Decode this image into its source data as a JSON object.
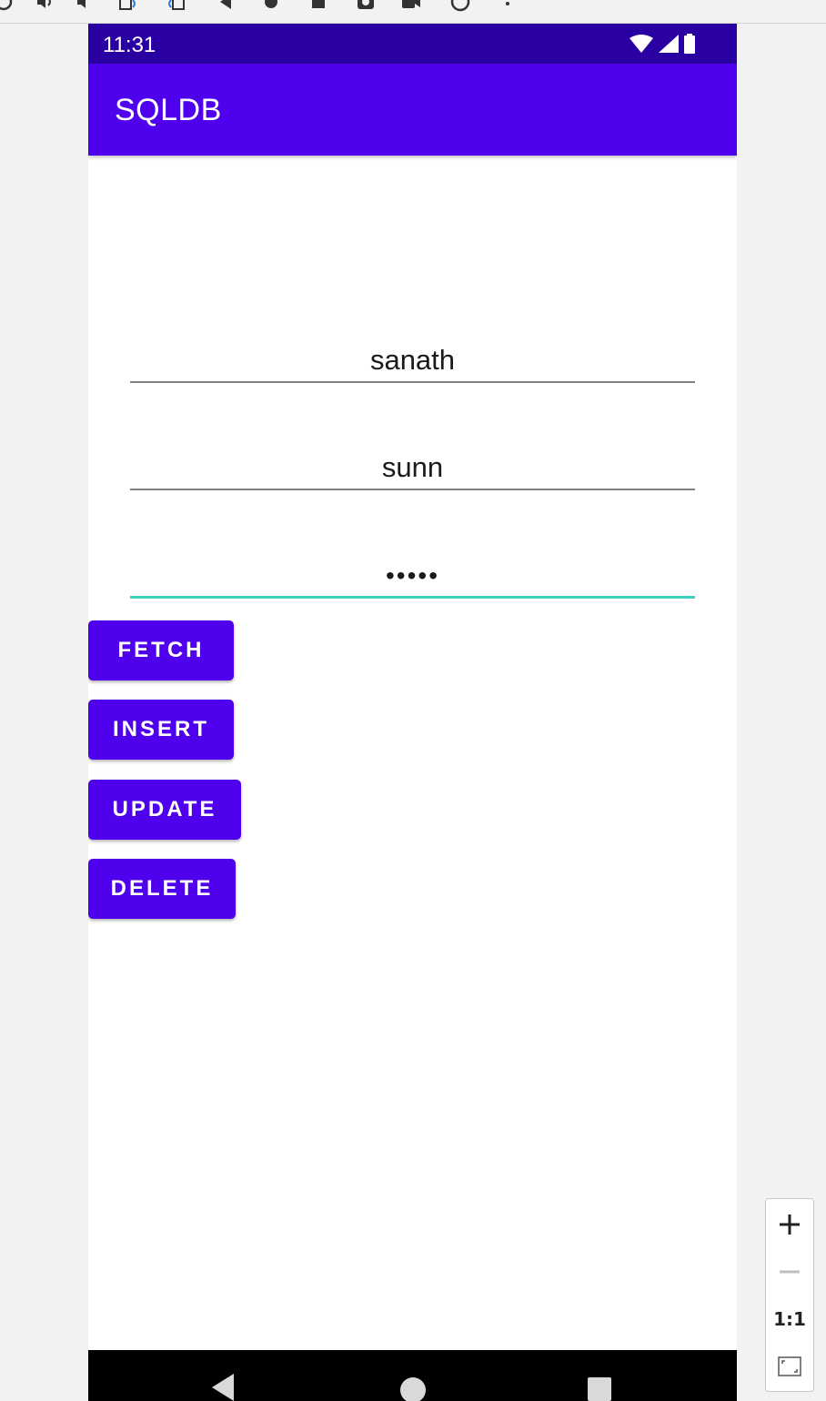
{
  "status_bar": {
    "time": "11:31"
  },
  "app_bar": {
    "title": "SQLDB"
  },
  "form": {
    "name_value": "sanath",
    "username_value": "sunn",
    "password_value": "•••••"
  },
  "buttons": {
    "fetch": "FETCH",
    "insert": "INSERT",
    "update": "UPDATE",
    "delete": "DELETE"
  },
  "zoom": {
    "one_to_one": "1:1"
  },
  "colors": {
    "primary": "#4f00ec",
    "status_bar": "#2a00a2",
    "accent": "#3ccfc0"
  }
}
